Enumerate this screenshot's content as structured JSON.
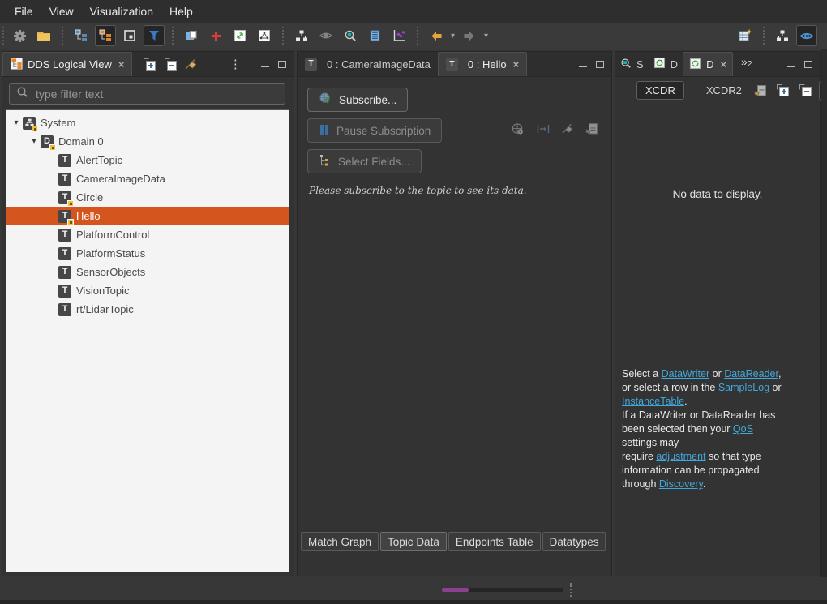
{
  "menu": {
    "items": [
      {
        "label": "File"
      },
      {
        "label": "View"
      },
      {
        "label": "Visualization"
      },
      {
        "label": "Help"
      }
    ]
  },
  "glyphs": {
    "close": "×",
    "dropdown": "▾",
    "kebab": "⋮",
    "chevrons": "»",
    "expanded_arrow": "▾"
  },
  "toolbar": {
    "icons": [
      "settings-gear",
      "open-folder",
      "logical-tree-blue",
      "logical-tree-orange",
      "frame-select",
      "filter-funnel",
      "new-panel",
      "add-plus",
      "export-box",
      "node-graph-box",
      "hierarchy",
      "eye",
      "zoom-search",
      "data-log",
      "scatter-chart",
      "back-arrow",
      "back-dropdown",
      "forward-arrow",
      "forward-dropdown",
      "new-table",
      "hierarchy",
      "eye-toggle"
    ]
  },
  "left_panel": {
    "title": "DDS Logical View",
    "filter": {
      "placeholder": "type filter text"
    },
    "header_icons": [
      "expand-all",
      "collapse-all",
      "broom",
      "view-menu",
      "minimize",
      "maximize"
    ],
    "tree": [
      {
        "label": "System",
        "level": 0,
        "icon": "system",
        "badge": true,
        "expanded": true
      },
      {
        "label": "Domain 0",
        "level": 1,
        "icon": "domain",
        "badge": true,
        "expanded": true
      },
      {
        "label": "AlertTopic",
        "level": 2,
        "icon": "topic"
      },
      {
        "label": "CameraImageData",
        "level": 2,
        "icon": "topic"
      },
      {
        "label": "Circle",
        "level": 2,
        "icon": "topic",
        "badge": true
      },
      {
        "label": "Hello",
        "level": 2,
        "icon": "topic",
        "badge": true,
        "selected": true
      },
      {
        "label": "PlatformControl",
        "level": 2,
        "icon": "topic"
      },
      {
        "label": "PlatformStatus",
        "level": 2,
        "icon": "topic"
      },
      {
        "label": "SensorObjects",
        "level": 2,
        "icon": "topic"
      },
      {
        "label": "VisionTopic",
        "level": 2,
        "icon": "topic"
      },
      {
        "label": "rt/LidarTopic",
        "level": 2,
        "icon": "topic"
      }
    ]
  },
  "center_panel": {
    "tabs": [
      {
        "label": "0 : CameraImageData",
        "icon_letter": "T",
        "active": false,
        "closable": false
      },
      {
        "label": "0 : Hello",
        "icon_letter": "T",
        "active": true,
        "closable": true
      }
    ],
    "subscribe_button": "Subscribe...",
    "pause_button": "Pause Subscription",
    "select_fields_button": "Select Fields...",
    "hint": "Please subscribe to the topic to see its data.",
    "action_icons": [
      "globe-settings",
      "width-adjust",
      "broom",
      "copy-document"
    ],
    "bottom_tabs": [
      {
        "label": "Match Graph",
        "active": false
      },
      {
        "label": "Topic Data",
        "active": true
      },
      {
        "label": "Endpoints Table",
        "active": false
      },
      {
        "label": "Datatypes",
        "active": false
      }
    ]
  },
  "right_panel": {
    "tabs": [
      {
        "label": "S",
        "icon": "search",
        "active": false,
        "closable": false
      },
      {
        "label": "D",
        "icon": "datatype",
        "active": false,
        "closable": false
      },
      {
        "label": "D",
        "icon": "datatype",
        "active": true,
        "closable": true
      }
    ],
    "overflow_indicator": {
      "symbol": "»",
      "count": "2"
    },
    "encoding_buttons": [
      {
        "label": "XCDR",
        "pressed": true
      },
      {
        "label": "XCDR2",
        "pressed": false
      }
    ],
    "toolbar_icons": [
      "paste-document",
      "expand-all",
      "collapse-all",
      "swap-arrows"
    ],
    "empty_message": "No data to display.",
    "help": {
      "segments": [
        {
          "text": "Select a "
        },
        {
          "link": "DataWriter"
        },
        {
          "text": " or "
        },
        {
          "link": "DataReader"
        },
        {
          "text": ",\nor select a row in the "
        },
        {
          "link": "SampleLog"
        },
        {
          "text": " or\n"
        },
        {
          "link": "InstanceTable"
        },
        {
          "text": ".\nIf a DataWriter or DataReader has\nbeen selected then your "
        },
        {
          "link": "QoS"
        },
        {
          "text": "\nsettings may\nrequire "
        },
        {
          "link": "adjustment"
        },
        {
          "text": " so that type\ninformation can be propagated\nthrough "
        },
        {
          "link": "Discovery"
        },
        {
          "text": "."
        }
      ]
    }
  },
  "statusbar": {
    "progress_percent": 22
  },
  "colors": {
    "selection": "#d4551d",
    "link": "#41a8dd",
    "accent_orange": "#e2a43b",
    "progress": "#8b4090"
  }
}
